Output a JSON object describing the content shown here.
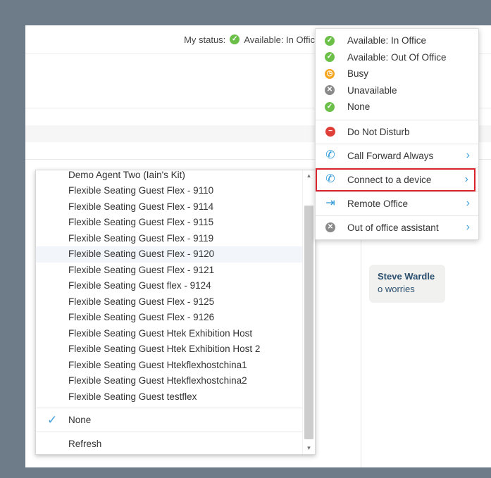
{
  "status_bar": {
    "label": "My status:",
    "current_status": "Available: In Offic",
    "status_color": "#6cc04a"
  },
  "chat": {
    "name": "Steve Wardle",
    "text": "o worries"
  },
  "device_dropdown": {
    "items": [
      "Demo Agent Two (Iain's Kit)",
      "Flexible Seating Guest Flex - 9110",
      "Flexible Seating Guest Flex - 9114",
      "Flexible Seating Guest Flex - 9115",
      "Flexible Seating Guest Flex - 9119",
      "Flexible Seating Guest Flex - 9120",
      "Flexible Seating Guest Flex - 9121",
      "Flexible Seating Guest flex - 9124",
      "Flexible Seating Guest Flex - 9125",
      "Flexible Seating Guest Flex - 9126",
      "Flexible Seating Guest Htek Exhibition Host",
      "Flexible Seating Guest Htek Exhibition Host 2",
      "Flexible Seating Guest Htekflexhostchina1",
      "Flexible Seating Guest Htekflexhostchina2",
      "Flexible Seating Guest testflex"
    ],
    "hovered_index": 5,
    "selected_label": "None",
    "refresh_label": "Refresh",
    "check_icon": "check-icon",
    "accent_color": "#3e9fdc"
  },
  "status_menu": {
    "statuses": [
      {
        "label": "Available: In Office",
        "icon": "check-circle-icon",
        "color": "#6cc04a"
      },
      {
        "label": "Available: Out Of Office",
        "icon": "check-circle-icon",
        "color": "#6cc04a"
      },
      {
        "label": "Busy",
        "icon": "clock-icon",
        "color": "#f5a623"
      },
      {
        "label": "Unavailable",
        "icon": "x-circle-icon",
        "color": "#8a8a8a"
      },
      {
        "label": "None",
        "icon": "check-circle-icon",
        "color": "#6cc04a"
      }
    ],
    "dnd_label": "Do Not Disturb",
    "dnd_color": "#e0403a",
    "call_forward_label": "Call Forward Always",
    "connect_device_label": "Connect to a device",
    "remote_office_label": "Remote Office",
    "ooo_assistant_label": "Out of office assistant",
    "highlight_color": "#d9232d"
  }
}
